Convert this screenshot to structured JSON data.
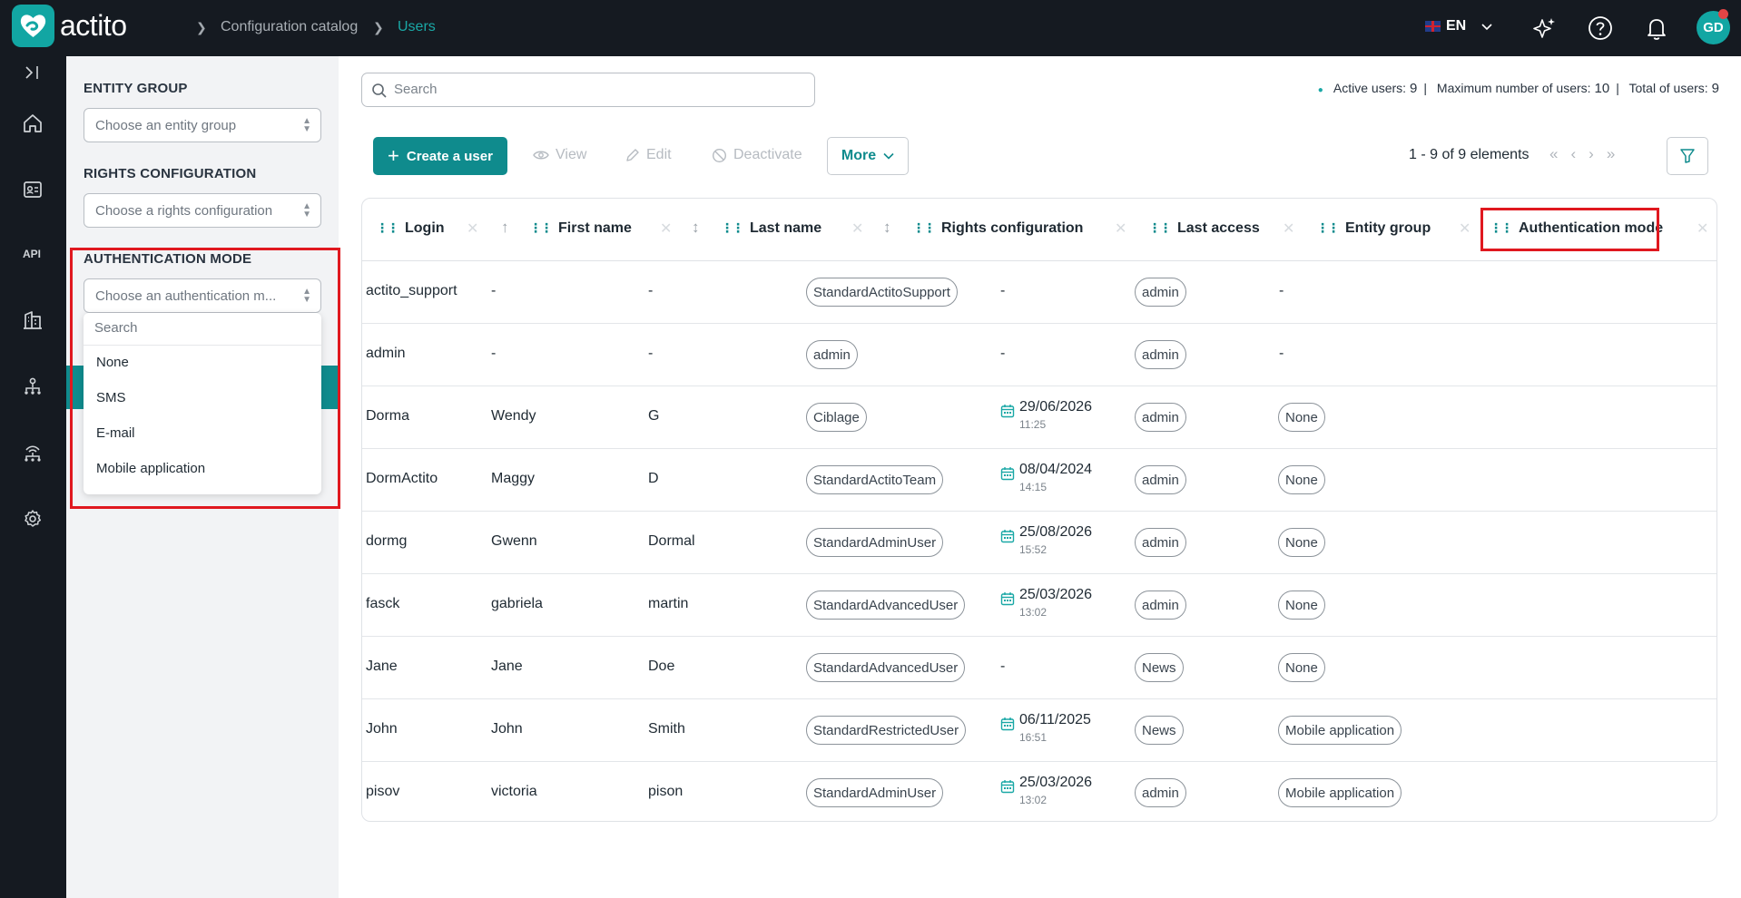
{
  "app": {
    "brand": "actito",
    "avatar_initials": "GD",
    "language": "EN"
  },
  "breadcrumb": [
    "Configuration catalog",
    "Users"
  ],
  "filters": {
    "entity_group": {
      "label": "ENTITY GROUP",
      "placeholder": "Choose an entity group"
    },
    "rights_configuration": {
      "label": "RIGHTS CONFIGURATION",
      "placeholder": "Choose a rights configuration"
    },
    "authentication_mode": {
      "label": "AUTHENTICATION MODE",
      "placeholder": "Choose an authentication m...",
      "dropdown": {
        "search_placeholder": "Search",
        "options": [
          "None",
          "SMS",
          "E-mail",
          "Mobile application"
        ]
      }
    }
  },
  "search": {
    "placeholder": "Search"
  },
  "stats": {
    "active_label": "Active users:",
    "active": "9",
    "max_label": "Maximum number of users:",
    "max": "10",
    "total_label": "Total of users:",
    "total": "9"
  },
  "toolbar": {
    "create": "Create a user",
    "view": "View",
    "edit": "Edit",
    "deactivate": "Deactivate",
    "more": "More"
  },
  "pagination": {
    "text": "1 - 9 of 9 elements"
  },
  "table": {
    "columns": [
      "Login",
      "First name",
      "Last name",
      "Rights configuration",
      "Last access",
      "Entity group",
      "Authentication mode"
    ],
    "rows": [
      {
        "login": "actito_support",
        "first": "-",
        "last": "-",
        "rights": "StandardActitoSupport",
        "date": "",
        "time": "",
        "access_text": "-",
        "group": "admin",
        "auth": "",
        "auth_text": "-"
      },
      {
        "login": "admin",
        "first": "-",
        "last": "-",
        "rights": "admin",
        "date": "",
        "time": "",
        "access_text": "-",
        "group": "admin",
        "auth": "",
        "auth_text": "-"
      },
      {
        "login": "Dorma",
        "first": "Wendy",
        "last": "G",
        "rights": "Ciblage",
        "date": "29/06/2026",
        "time": "11:25",
        "access_text": "",
        "group": "admin",
        "auth": "None",
        "auth_text": ""
      },
      {
        "login": "DormActito",
        "first": "Maggy",
        "last": "D",
        "rights": "StandardActitoTeam",
        "date": "08/04/2024",
        "time": "14:15",
        "access_text": "",
        "group": "admin",
        "auth": "None",
        "auth_text": ""
      },
      {
        "login": "dormg",
        "first": "Gwenn",
        "last": "Dormal",
        "rights": "StandardAdminUser",
        "date": "25/08/2026",
        "time": "15:52",
        "access_text": "",
        "group": "admin",
        "auth": "None",
        "auth_text": ""
      },
      {
        "login": "fasck",
        "first": "gabriela",
        "last": "martin",
        "rights": "StandardAdvancedUser",
        "date": "25/03/2026",
        "time": "13:02",
        "access_text": "",
        "group": "admin",
        "auth": "None",
        "auth_text": ""
      },
      {
        "login": "Jane",
        "first": "Jane",
        "last": "Doe",
        "rights": "StandardAdvancedUser",
        "date": "",
        "time": "",
        "access_text": "-",
        "group": "News",
        "auth": "None",
        "auth_text": ""
      },
      {
        "login": "John",
        "first": "John",
        "last": "Smith",
        "rights": "StandardRestrictedUser",
        "date": "06/11/2025",
        "time": "16:51",
        "access_text": "",
        "group": "News",
        "auth": "Mobile application",
        "auth_text": ""
      },
      {
        "login": "pisov",
        "first": "victoria",
        "last": "pison",
        "rights": "StandardAdminUser",
        "date": "25/03/2026",
        "time": "13:02",
        "access_text": "",
        "group": "admin",
        "auth": "Mobile application",
        "auth_text": ""
      }
    ]
  },
  "colors": {
    "accent": "#0f8b8d",
    "topbar": "#151a21",
    "highlight": "#e0181f"
  }
}
